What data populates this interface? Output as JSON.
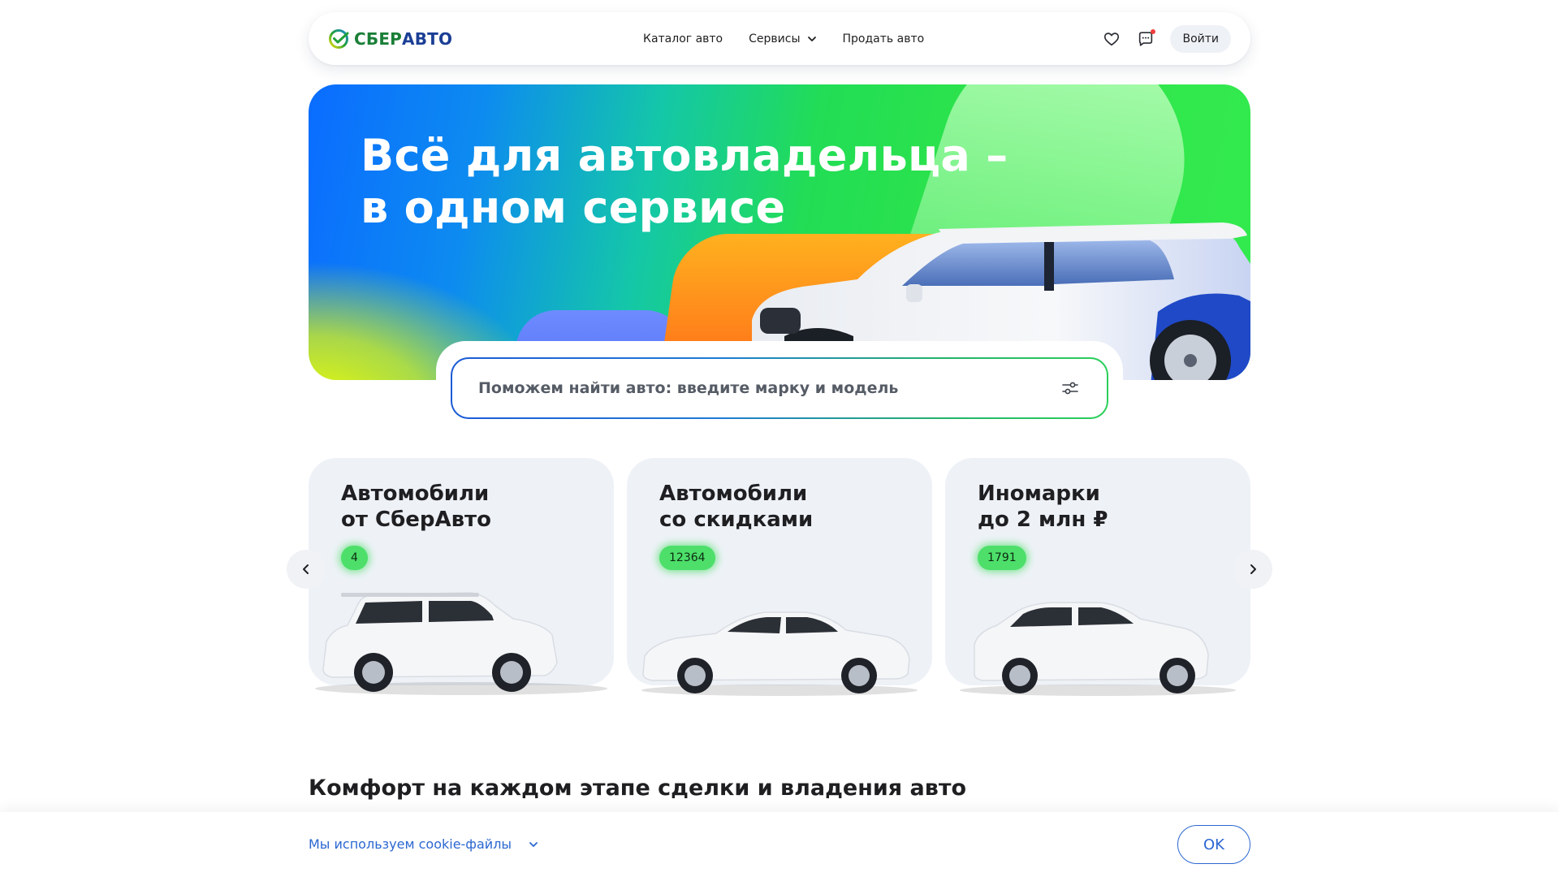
{
  "brand": {
    "part1": "СБЕР",
    "part2": "АВТО",
    "color_green": "#1a7f37",
    "color_blue": "#1b3f95"
  },
  "header": {
    "nav": [
      {
        "label": "Каталог авто"
      },
      {
        "label": "Сервисы",
        "icon": "chevron-down-icon"
      },
      {
        "label": "Продать авто"
      }
    ],
    "favorites_icon": "heart-icon",
    "chat_icon": "chat-icon",
    "login_label": "Войти"
  },
  "hero": {
    "title_line1": "Всё для автовладельца –",
    "title_line2": "в одном сервисе"
  },
  "search": {
    "placeholder": "Поможем найти авто: введите марку и модель",
    "filter_icon": "filter-sliders-icon"
  },
  "cards": [
    {
      "title": "Автомобили\nот СберАвто",
      "count": "4",
      "car": "suv"
    },
    {
      "title": "Автомобили\nсо скидками",
      "count": "12364",
      "car": "sedan"
    },
    {
      "title": "Иномарки\nдо 2 млн ₽",
      "count": "1791",
      "car": "hatchback"
    }
  ],
  "carousel": {
    "prev_icon": "chevron-left-icon",
    "next_icon": "chevron-right-icon"
  },
  "section": {
    "title": "Комфорт на каждом этапе сделки и владения авто"
  },
  "cookie": {
    "text": "Мы используем cookie-файлы",
    "ok_label": "OK",
    "accent": "#2b67d1"
  }
}
